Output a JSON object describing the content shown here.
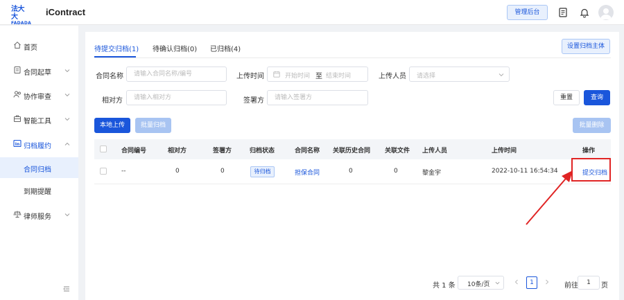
{
  "brand": {
    "logo_cn": "法大大",
    "logo_en": "FADADA",
    "app_name": "iContract",
    "accent": "#1a56db"
  },
  "topbar": {
    "admin_label": "管理后台",
    "icons": [
      "document-icon",
      "bell-icon",
      "avatar"
    ]
  },
  "sidebar": {
    "items": [
      {
        "label": "首页",
        "icon": "home-icon"
      },
      {
        "label": "合同起草",
        "icon": "draft-icon"
      },
      {
        "label": "协作审查",
        "icon": "review-icon"
      },
      {
        "label": "智能工具",
        "icon": "toolbox-icon"
      },
      {
        "label": "归档履约",
        "icon": "archive-icon"
      },
      {
        "label": "律师服务",
        "icon": "scales-icon"
      }
    ],
    "sub_items": [
      {
        "label": "合同归档"
      },
      {
        "label": "到期提醒"
      }
    ]
  },
  "tabs": [
    {
      "label": "待提交归档(1)"
    },
    {
      "label": "待确认归档(0)"
    },
    {
      "label": "已归档(4)"
    }
  ],
  "set_archive_subject": "设置归档主体",
  "filters": {
    "contract_name": {
      "label": "合同名称",
      "placeholder": "请输入合同名称/编号"
    },
    "upload_time": {
      "label": "上传时间",
      "start": "开始时间",
      "separator": "至",
      "end": "结束时间"
    },
    "uploader": {
      "label": "上传人员",
      "placeholder": "请选择"
    },
    "counterparty": {
      "label": "相对方",
      "placeholder": "请输入相对方"
    },
    "signer": {
      "label": "签署方",
      "placeholder": "请输入签署方"
    }
  },
  "buttons": {
    "reset": "重置",
    "search": "查询",
    "local_upload": "本地上传",
    "batch_archive": "批量归档",
    "batch_delete": "批量删除"
  },
  "table": {
    "headers": [
      "合同编号",
      "相对方",
      "签署方",
      "归档状态",
      "合同名称",
      "关联历史合同",
      "关联文件",
      "上传人员",
      "上传时间",
      "操作"
    ],
    "rows": [
      {
        "contract_no": "--",
        "counterparty": "0",
        "signer": "0",
        "status": "待归档",
        "contract_name": "担保合同",
        "related_history": "0",
        "related_files": "0",
        "uploader": "黎金宇",
        "upload_time": "2022-10-11 16:54:34",
        "action": "提交归档"
      }
    ]
  },
  "pagination": {
    "total": "共 1 条",
    "page_size": "10条/页",
    "current_page": "1",
    "goto_label": "前往",
    "goto_value": "1",
    "page_suffix": "页"
  }
}
